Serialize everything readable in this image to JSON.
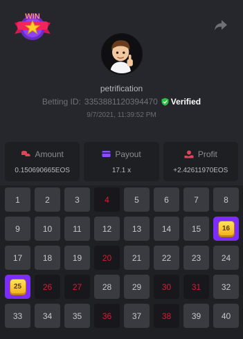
{
  "header": {
    "logo_text": "WIN",
    "username": "petrification",
    "betting_id_label": "Betting ID:",
    "betting_id": "3353881120394470",
    "verified_label": "Verified",
    "timestamp": "9/7/2021, 11:39:52 PM"
  },
  "stats": [
    {
      "label": "Amount",
      "value": "0.150690665EOS",
      "icon": "coins-icon",
      "color": "#e0445a"
    },
    {
      "label": "Payout",
      "value": "17.1 x",
      "icon": "wallet-icon",
      "color": "#8c4dff"
    },
    {
      "label": "Profit",
      "value": "+2.42611970EOS",
      "icon": "hand-coin-icon",
      "color": "#e0445a"
    }
  ],
  "grid": {
    "cells": [
      {
        "n": "1",
        "s": "normal"
      },
      {
        "n": "2",
        "s": "normal"
      },
      {
        "n": "3",
        "s": "normal"
      },
      {
        "n": "4",
        "s": "hot"
      },
      {
        "n": "5",
        "s": "normal"
      },
      {
        "n": "6",
        "s": "normal"
      },
      {
        "n": "7",
        "s": "normal"
      },
      {
        "n": "8",
        "s": "normal"
      },
      {
        "n": "9",
        "s": "normal"
      },
      {
        "n": "10",
        "s": "normal"
      },
      {
        "n": "11",
        "s": "normal"
      },
      {
        "n": "12",
        "s": "normal"
      },
      {
        "n": "13",
        "s": "normal"
      },
      {
        "n": "14",
        "s": "normal"
      },
      {
        "n": "15",
        "s": "normal"
      },
      {
        "n": "16",
        "s": "mine"
      },
      {
        "n": "17",
        "s": "normal"
      },
      {
        "n": "18",
        "s": "normal"
      },
      {
        "n": "19",
        "s": "normal"
      },
      {
        "n": "20",
        "s": "hot"
      },
      {
        "n": "21",
        "s": "normal"
      },
      {
        "n": "22",
        "s": "normal"
      },
      {
        "n": "23",
        "s": "normal"
      },
      {
        "n": "24",
        "s": "normal"
      },
      {
        "n": "25",
        "s": "mine"
      },
      {
        "n": "26",
        "s": "hot"
      },
      {
        "n": "27",
        "s": "hot"
      },
      {
        "n": "28",
        "s": "normal"
      },
      {
        "n": "29",
        "s": "normal"
      },
      {
        "n": "30",
        "s": "hot"
      },
      {
        "n": "31",
        "s": "hot"
      },
      {
        "n": "32",
        "s": "normal"
      },
      {
        "n": "33",
        "s": "normal"
      },
      {
        "n": "34",
        "s": "normal"
      },
      {
        "n": "35",
        "s": "normal"
      },
      {
        "n": "36",
        "s": "hot"
      },
      {
        "n": "37",
        "s": "normal"
      },
      {
        "n": "38",
        "s": "hot"
      },
      {
        "n": "39",
        "s": "normal"
      },
      {
        "n": "40",
        "s": "normal"
      }
    ]
  },
  "colors": {
    "accent_purple": "#7d2cff",
    "hit_red": "#d21f35",
    "verified_green": "#27c23f",
    "gold_tile": "#f3b01b"
  }
}
